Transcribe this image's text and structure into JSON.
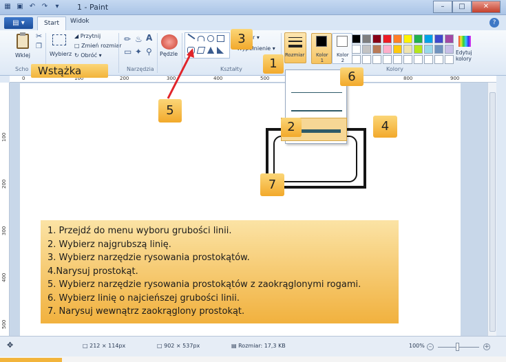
{
  "window": {
    "title": "1 - Paint"
  },
  "tabs": {
    "file_label": "▤ ▾",
    "start": "Start",
    "view": "Widok",
    "help": "?"
  },
  "ribbon": {
    "clipboard": {
      "paste": "Wklej",
      "group": "Scho"
    },
    "image": {
      "select": "Wybierz",
      "crop": "Przytnij",
      "resize": "Zmień rozmiar",
      "rotate": "Obróć ▾"
    },
    "tools": {
      "group": "Narzędzia",
      "text_glyph": "A"
    },
    "brushes": {
      "label": "Pędzle"
    },
    "shapes": {
      "group": "Kształty",
      "outline": "Kontur ▾",
      "fill": "Wypełnienie ▾"
    },
    "size": {
      "label": "Rozmiar"
    },
    "color1": {
      "label": "Kolor\n1"
    },
    "color2": {
      "label": "Kolor\n2"
    },
    "colors": {
      "group": "Kolory",
      "edit": "Edytuj kolory"
    },
    "palette": [
      "#000000",
      "#7f7f7f",
      "#880015",
      "#ed1c24",
      "#ff7f27",
      "#fff200",
      "#22b14c",
      "#00a2e8",
      "#3f48cc",
      "#a349a4",
      "#ffffff",
      "#c3c3c3",
      "#b97a57",
      "#ffaec9",
      "#ffc90e",
      "#efe4b0",
      "#b5e61d",
      "#99d9ea",
      "#7092be",
      "#c8bfe7",
      "#ffffff",
      "#ffffff",
      "#ffffff",
      "#ffffff",
      "#ffffff",
      "#ffffff",
      "#ffffff",
      "#ffffff",
      "#ffffff",
      "#ffffff"
    ]
  },
  "ruler": {
    "top": [
      "0",
      "100",
      "200",
      "300",
      "400",
      "500",
      "800",
      "900"
    ],
    "left": [
      "100",
      "200",
      "300",
      "400",
      "500"
    ]
  },
  "annotations": {
    "ribbon_label": "Wstążka",
    "b1": "1",
    "b2": "2",
    "b3": "3",
    "b4": "4",
    "b5": "5",
    "b6": "6",
    "b7": "7"
  },
  "instructions": [
    "1. Przejdź do menu wyboru grubości linii.",
    "2. Wybierz najgrubszą linię.",
    "3. Wybierz narzędzie rysowania prostokątów.",
    "4.Narysuj prostokąt.",
    "5. Wybierz narzędzie rysowania prostokątów z zaokrąglonymi rogami.",
    "6. Wybierz linię o najcieńszej grubości linii.",
    "7. Narysuj wewnątrz zaokrąglony prostokąt."
  ],
  "status": {
    "selection_size": "212 × 114px",
    "image_size": "902 × 537px",
    "file_size": "Rozmiar: 17,3 KB",
    "zoom": "100%"
  }
}
